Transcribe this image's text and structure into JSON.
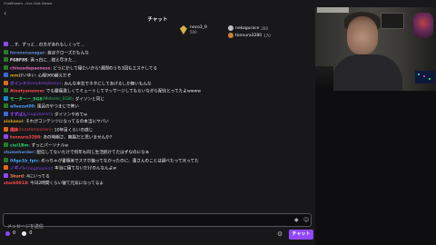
{
  "window": {
    "title": "ChatStream - Live Chat Viewer"
  },
  "chat": {
    "title": "チャット",
    "back_icon": "chevron-left-icon"
  },
  "leaderboard": {
    "first": {
      "name": "neco3_9",
      "points": "500"
    },
    "others": [
      {
        "rank": "2",
        "name": "nekogurace",
        "points": "200",
        "color": "#c0c0c0"
      },
      {
        "rank": "3",
        "name": "tonnura3280",
        "points": "170",
        "color": "#cd7f32"
      }
    ]
  },
  "messages": [
    {
      "user": "",
      "text": "…す、ずっと…の方があれもしくって…",
      "color": "#adadb8",
      "badge": "#9147ff"
    },
    {
      "user": "hirononanager",
      "text": ": 自ぼクローズだもんな",
      "color": "#5b8bd6",
      "badge": "#2a7a2a"
    },
    {
      "user": "F6BF8S",
      "text": ": 真っ白に…燃え尽きた…",
      "color": "#e6e6e6",
      "badge": "#2a7a2a"
    },
    {
      "user": "chinzadepaeness",
      "text": ": どうにかして寝たいから!週間のうち3回もエステしてる",
      "color": "#e06ab8",
      "badge": "#2a7a2a"
    },
    {
      "user": "mm",
      "text": "けいゆい: 心経960越えだぞ",
      "color": "#d4a017",
      "badge": "#3b6ad6"
    },
    {
      "user": "ダインド",
      "user2": "(beepbeepbeep)",
      "text": ": みんな本気でネタにしてあげるしか無いもんな",
      "color": "#9147ff",
      "badge": "#e06a1a"
    },
    {
      "user": "Ainatyananow",
      "text": ": でも腰痛激しくてミュートしてマッサージしてもらいながら配信とってたよwwww",
      "color": "#ff4a4a",
      "badge": "#2a7a2a"
    },
    {
      "user": "モーターー_SG8",
      "user2": "(Motorer_SG8)",
      "text": ": ダイソンと同じ",
      "color": "#2bd46b",
      "badge": "#1a8ad6"
    },
    {
      "user": "alleezat00",
      "text": ": 風呂のやつまじで怖い",
      "color": "#4aa3ff",
      "badge": "#2a7a2a"
    },
    {
      "user": "すずぱん",
      "user2": "(sugubanin)",
      "text": ": ダイソンやめてw",
      "color": "#9147ff",
      "badge": "#3b6ad6"
    },
    {
      "user": "siokasui",
      "text": ": それがコンテンツになってるの本当にヤバい",
      "color": "#d4a017",
      "badge": ""
    },
    {
      "user": "橋鉢",
      "user2": "(tosatomochan)",
      "text": ": 10年目くらいの感じ",
      "color": "#ff4a4a",
      "badge": "#e06a1a"
    },
    {
      "user": "tonnura3280",
      "text": ": あの時期さ、無脂だと思いませんか?",
      "color": "#ff4a4a",
      "badge": "#9147ff"
    },
    {
      "user": "ciel1Bm",
      "text": ": ずっとパーソナルw",
      "color": "#2bd46b",
      "badge": "#2a7a2a"
    },
    {
      "user": "stumeharder",
      "text": ": 配信してないだけで何年も同じ生活続けてたはずなのになぁ",
      "color": "#5b8bd6",
      "badge": ""
    },
    {
      "user": "00go1b_fpic",
      "text": ": めっちゃが書類美でスマホ軸ってなかったのに、蓮さんのことは調べたって言ってた",
      "color": "#4aa3ff",
      "badge": "#2a7a2a"
    },
    {
      "user": "ノギノレ",
      "user2": "(nogimonio)",
      "text": ": 本当に寝てないだけのんなんよw",
      "color": "#9147ff",
      "badge": "#e06a1a"
    },
    {
      "user": "3kurd",
      "text": ": 4にいってる",
      "color": "#ff7f50",
      "badge": "#9147ff"
    },
    {
      "user": "stark0018",
      "text": ": 今日2時間くらい寝て元気になってるよ",
      "color": "#ff4a4a",
      "badge": ""
    }
  ],
  "input": {
    "placeholder": "メッセージを送信",
    "icons": [
      "bits-icon",
      "emote-icon"
    ]
  },
  "footer": {
    "points_a": "0",
    "points_b": "0",
    "chat_button": "チャット"
  },
  "colors": {
    "accent": "#9147ff",
    "background": "#18181b"
  }
}
